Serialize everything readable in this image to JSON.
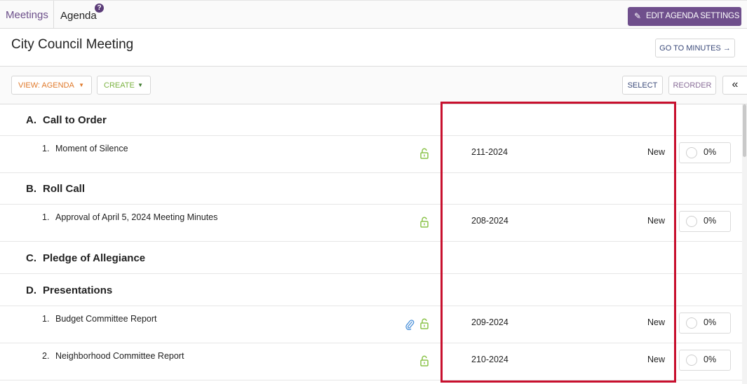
{
  "topbar": {
    "meetings_tab": "Meetings",
    "agenda_tab": "Agenda",
    "help_glyph": "?",
    "edit_button": "EDIT AGENDA SETTINGS",
    "edit_icon": "pencil-icon"
  },
  "header": {
    "title": "City Council Meeting",
    "minutes_button": "GO TO MINUTES →"
  },
  "toolbar": {
    "view_button": "VIEW: AGENDA",
    "create_button": "CREATE",
    "select_button": "SELECT",
    "reorder_button": "REORDER",
    "collapse_glyph": "«"
  },
  "colors": {
    "brand_purple": "#6f4f8c",
    "view_orange": "#e07a2c",
    "create_green": "#7cb342",
    "highlight_red": "#c8102e"
  },
  "agenda": {
    "sections": [
      {
        "letter": "A.",
        "title": "Call to Order"
      },
      {
        "letter": "B.",
        "title": "Roll Call"
      },
      {
        "letter": "C.",
        "title": "Pledge of Allegiance"
      },
      {
        "letter": "D.",
        "title": "Presentations"
      }
    ],
    "items": [
      {
        "num": "1.",
        "title": "Moment of Silence",
        "number": "211-2024",
        "status": "New",
        "progress": "0%"
      },
      {
        "num": "1.",
        "title": "Approval of April 5, 2024 Meeting Minutes",
        "number": "208-2024",
        "status": "New",
        "progress": "0%"
      },
      {
        "num": "1.",
        "title": "Budget Committee Report",
        "number": "209-2024",
        "status": "New",
        "progress": "0%"
      },
      {
        "num": "2.",
        "title": "Neighborhood Committee Report",
        "number": "210-2024",
        "status": "New",
        "progress": "0%"
      }
    ]
  }
}
